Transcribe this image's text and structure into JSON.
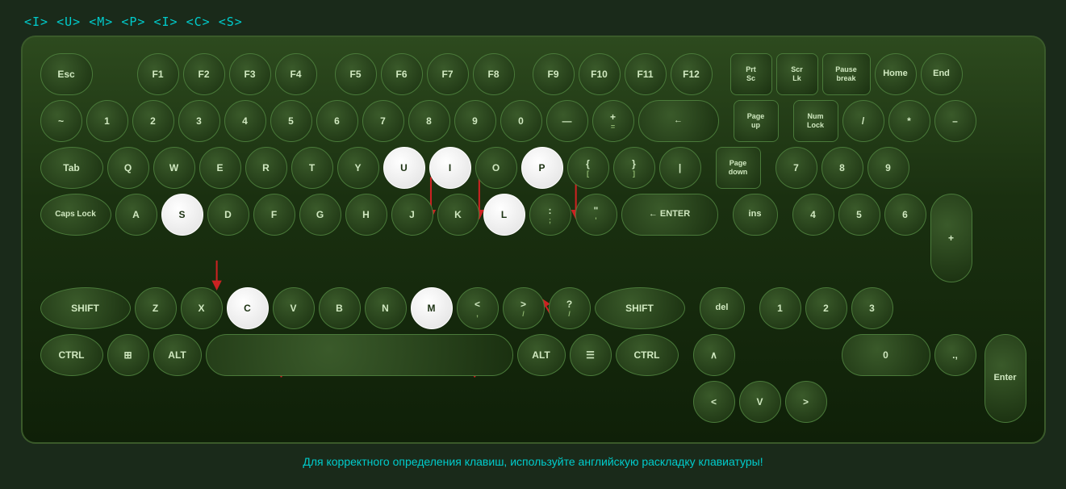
{
  "topBar": {
    "text": "<I>  <U>  <M>  <P>  <I>  <C>  <S>"
  },
  "bottomNote": "Для корректного определения клавиш, используйте английскую раскладку клавиатуры!",
  "keyboard": {
    "highlightedKeys": [
      "U",
      "I",
      "S",
      "L",
      "C",
      "M",
      "P"
    ],
    "rows": {
      "row0": [
        "Esc",
        "",
        "F1",
        "F2",
        "F3",
        "F4",
        "",
        "F5",
        "F6",
        "F7",
        "F8",
        "",
        "F9",
        "F10",
        "F11",
        "F12",
        "",
        "PrtSc",
        "ScrLk",
        "Pause break",
        "Home",
        "End"
      ],
      "row1": [
        "~",
        "1",
        "2",
        "3",
        "4",
        "5",
        "6",
        "7",
        "8",
        "9",
        "0",
        "—",
        "±=",
        "←",
        "Page up",
        "Num Lock",
        "/",
        "*",
        "–"
      ],
      "row2": [
        "Tab",
        "Q",
        "W",
        "E",
        "R",
        "T",
        "Y",
        "U",
        "I",
        "O",
        "P",
        "{[",
        "}]",
        "|\\ ",
        "Page down",
        "7",
        "8",
        "9"
      ],
      "row3": [
        "Caps Lock",
        "A",
        "S",
        "D",
        "F",
        "G",
        "H",
        "J",
        "K",
        "L",
        ";:",
        "\"'",
        "← ENTER",
        "ins",
        "4",
        "5",
        "6"
      ],
      "row4": [
        "SHIFT",
        "Z",
        "X",
        "C",
        "V",
        "B",
        "N",
        "M",
        "<,",
        ">/",
        "?/",
        "SHIFT",
        "del",
        "1",
        "2",
        "3"
      ],
      "row5": [
        "CTRL",
        "WIN",
        "ALT",
        "",
        "ALT",
        "☰",
        "CTRL",
        "∧",
        "0",
        ".,"
      ],
      "row6": [
        "",
        "",
        "",
        "<",
        "V",
        ">"
      ]
    }
  }
}
